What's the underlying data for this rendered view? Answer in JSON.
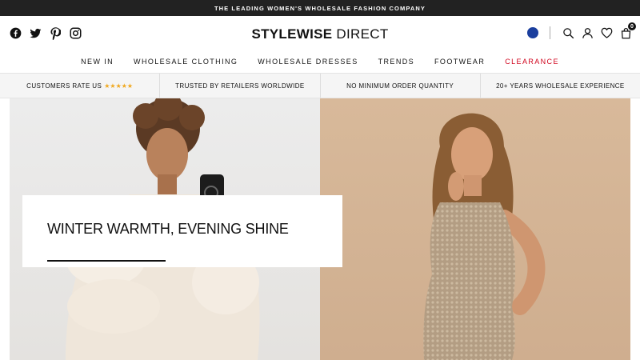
{
  "announcement": "THE LEADING WOMEN'S WHOLESALE FASHION COMPANY",
  "brand": {
    "bold": "STYLEWISE",
    "light": " DIRECT"
  },
  "social": [
    "facebook-icon",
    "twitter-icon",
    "pinterest-icon",
    "instagram-icon"
  ],
  "header": {
    "bag_count": "0"
  },
  "nav": [
    {
      "label": "NEW IN"
    },
    {
      "label": "WHOLESALE CLOTHING"
    },
    {
      "label": "WHOLESALE DRESSES"
    },
    {
      "label": "TRENDS"
    },
    {
      "label": "FOOTWEAR"
    },
    {
      "label": "CLEARANCE"
    }
  ],
  "usp": [
    {
      "label": "CUSTOMERS RATE US",
      "stars": "★★★★★"
    },
    {
      "label": "TRUSTED BY RETAILERS WORLDWIDE"
    },
    {
      "label": "NO MINIMUM ORDER QUANTITY"
    },
    {
      "label": "20+ YEARS WHOLESALE EXPERIENCE"
    }
  ],
  "hero": {
    "title": "WINTER WARMTH, EVENING SHINE"
  },
  "colors": {
    "accent_sale": "#d0021b",
    "topbar": "#222222",
    "stars": "#f0a81f"
  }
}
